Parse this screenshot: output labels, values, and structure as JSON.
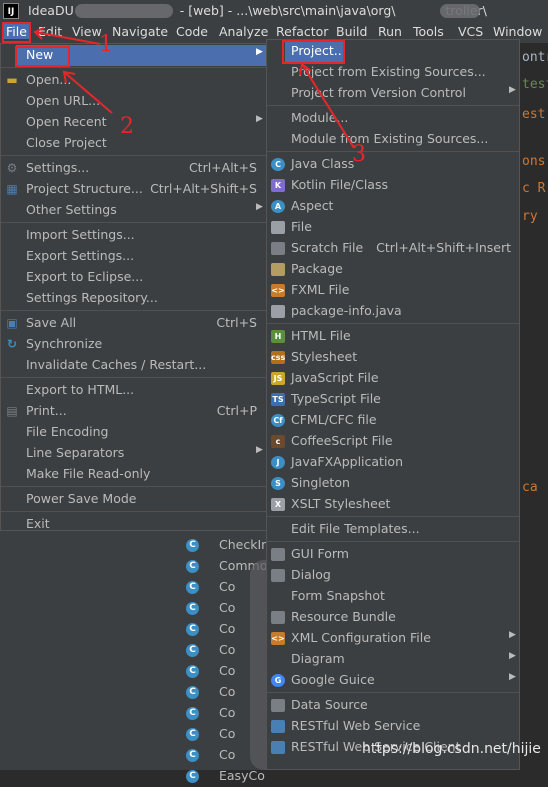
{
  "title_bar": {
    "app_name": "IdeaDU",
    "project": "- [web] -",
    "path": "...\\web\\src\\main\\java\\org\\",
    "path_tail": "troller\\"
  },
  "menubar": [
    "File",
    "Edit",
    "View",
    "Navigate",
    "Code",
    "Analyze",
    "Refactor",
    "Build",
    "Run",
    "Tools",
    "VCS",
    "Window"
  ],
  "editor_lines": [
    "ontr",
    "test",
    "est",
    "ons",
    "c R",
    "ry",
    "ca"
  ],
  "tree_items": [
    "CheckIn",
    "Commo",
    "Co",
    "Co",
    "Co",
    "Co",
    "Co",
    "Co",
    "Co",
    "Co",
    "Co",
    "EasyCo"
  ],
  "file_menu": [
    {
      "label": "New",
      "arrow": true,
      "selected": true
    },
    {
      "sep": true
    },
    {
      "label": "Open...",
      "icon": "folder-icon"
    },
    {
      "label": "Open URL..."
    },
    {
      "label": "Open Recent",
      "arrow": true
    },
    {
      "label": "Close Project"
    },
    {
      "sep": true
    },
    {
      "label": "Settings...",
      "shortcut": "Ctrl+Alt+S",
      "icon": "wrench-icon"
    },
    {
      "label": "Project Structure...",
      "shortcut": "Ctrl+Alt+Shift+S",
      "icon": "project-structure-icon"
    },
    {
      "label": "Other Settings",
      "arrow": true
    },
    {
      "sep": true
    },
    {
      "label": "Import Settings..."
    },
    {
      "label": "Export Settings..."
    },
    {
      "label": "Export to Eclipse..."
    },
    {
      "label": "Settings Repository..."
    },
    {
      "sep": true
    },
    {
      "label": "Save All",
      "shortcut": "Ctrl+S",
      "icon": "save-icon"
    },
    {
      "label": "Synchronize",
      "icon": "sync-icon"
    },
    {
      "label": "Invalidate Caches / Restart..."
    },
    {
      "sep": true
    },
    {
      "label": "Export to HTML..."
    },
    {
      "label": "Print...",
      "shortcut": "Ctrl+P",
      "icon": "print-icon"
    },
    {
      "label": "File Encoding"
    },
    {
      "label": "Line Separators",
      "arrow": true
    },
    {
      "label": "Make File Read-only"
    },
    {
      "sep": true
    },
    {
      "label": "Power Save Mode"
    },
    {
      "sep": true
    },
    {
      "label": "Exit"
    }
  ],
  "new_menu": [
    {
      "label": "Project...",
      "selected": true
    },
    {
      "label": "Project from Existing Sources..."
    },
    {
      "label": "Project from Version Control",
      "arrow": true
    },
    {
      "sep": true
    },
    {
      "label": "Module..."
    },
    {
      "label": "Module from Existing Sources..."
    },
    {
      "sep": true
    },
    {
      "label": "Java Class",
      "icon": "java-class-icon",
      "color": "#3b8fc4",
      "glyph": "C"
    },
    {
      "label": "Kotlin File/Class",
      "icon": "kotlin-icon",
      "color": "#7f6bd1",
      "glyph": "K"
    },
    {
      "label": "Aspect",
      "icon": "aspect-icon",
      "color": "#3b8fc4",
      "glyph": "A"
    },
    {
      "label": "File",
      "icon": "file-icon",
      "color": "#9aa0a6",
      "glyph": ""
    },
    {
      "label": "Scratch File",
      "shortcut": "Ctrl+Alt+Shift+Insert",
      "icon": "scratch-file-icon",
      "color": "#7a7f85",
      "glyph": ""
    },
    {
      "label": "Package",
      "icon": "package-icon",
      "color": "#b49d62",
      "glyph": ""
    },
    {
      "label": "FXML File",
      "icon": "fxml-icon",
      "color": "#c97b2d",
      "glyph": "<>"
    },
    {
      "label": "package-info.java",
      "icon": "package-info-icon",
      "color": "#9aa0a6",
      "glyph": ""
    },
    {
      "sep": true
    },
    {
      "label": "HTML File",
      "icon": "html-icon",
      "color": "#5a8f3b",
      "glyph": "H"
    },
    {
      "label": "Stylesheet",
      "icon": "css-icon",
      "color": "#b0701d",
      "glyph": "css"
    },
    {
      "label": "JavaScript File",
      "icon": "javascript-icon",
      "color": "#c9a62d",
      "glyph": "JS"
    },
    {
      "label": "TypeScript File",
      "icon": "typescript-icon",
      "color": "#3b6fb4",
      "glyph": "TS"
    },
    {
      "label": "CFML/CFC file",
      "icon": "cfml-icon",
      "color": "#3b8fc4",
      "glyph": "Cf"
    },
    {
      "label": "CoffeeScript File",
      "icon": "coffeescript-icon",
      "color": "#6b4a2d",
      "glyph": "c"
    },
    {
      "label": "JavaFXApplication",
      "icon": "javafx-icon",
      "color": "#3b8fc4",
      "glyph": "J"
    },
    {
      "label": "Singleton",
      "icon": "singleton-icon",
      "color": "#3b8fc4",
      "glyph": "S"
    },
    {
      "label": "XSLT Stylesheet",
      "icon": "xslt-icon",
      "color": "#9aa0a6",
      "glyph": "X"
    },
    {
      "sep": true
    },
    {
      "label": "Edit File Templates..."
    },
    {
      "sep": true
    },
    {
      "label": "GUI Form",
      "icon": "gui-form-icon",
      "color": "#7a7f85",
      "glyph": ""
    },
    {
      "label": "Dialog",
      "icon": "dialog-icon",
      "color": "#7a7f85",
      "glyph": ""
    },
    {
      "label": "Form Snapshot"
    },
    {
      "label": "Resource Bundle",
      "icon": "resource-bundle-icon",
      "color": "#7a7f85",
      "glyph": ""
    },
    {
      "label": "XML Configuration File",
      "arrow": true,
      "icon": "xml-icon",
      "color": "#c97b2d",
      "glyph": "<>"
    },
    {
      "label": "Diagram",
      "arrow": true
    },
    {
      "label": "Google Guice",
      "arrow": true,
      "icon": "google-guice-icon",
      "color": "#4285f4",
      "glyph": "G"
    },
    {
      "sep": true
    },
    {
      "label": "Data Source",
      "icon": "data-source-icon",
      "color": "#7a7f85",
      "glyph": ""
    },
    {
      "label": "RESTful Web Service",
      "icon": "rest-service-icon",
      "color": "#4a7fb4",
      "glyph": ""
    },
    {
      "label": "RESTful Web Service Client",
      "icon": "rest-client-icon",
      "color": "#4a7fb4",
      "glyph": ""
    }
  ],
  "annotations": [
    "1",
    "2",
    "3"
  ],
  "watermark": "https://blog.csdn.net/hijie"
}
